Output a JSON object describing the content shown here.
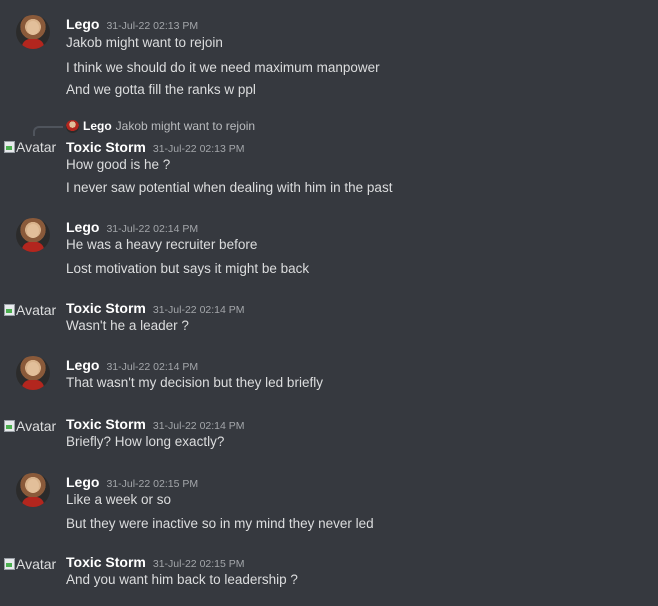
{
  "messages": [
    {
      "author": "Lego",
      "timestamp": "31-Jul-22 02:13 PM",
      "avatar": "round",
      "lines": [
        "Jakob might want to rejoin",
        "I think we should do it we need maximum manpower",
        "And we gotta fill the ranks w ppl"
      ]
    },
    {
      "author": "Toxic Storm",
      "timestamp": "31-Jul-22 02:13 PM",
      "avatar": "broken",
      "avatar_alt": "Avatar",
      "reply_to": {
        "author": "Lego",
        "text": "Jakob might want to rejoin"
      },
      "lines": [
        "How good is he ?",
        "I never saw potential when dealing with him in the past"
      ]
    },
    {
      "author": "Lego",
      "timestamp": "31-Jul-22 02:14 PM",
      "avatar": "round",
      "lines": [
        "He was a heavy recruiter before",
        "Lost motivation but says it might be back"
      ]
    },
    {
      "author": "Toxic Storm",
      "timestamp": "31-Jul-22 02:14 PM",
      "avatar": "broken",
      "avatar_alt": "Avatar",
      "lines": [
        "Wasn't he a leader ?"
      ]
    },
    {
      "author": "Lego",
      "timestamp": "31-Jul-22 02:14 PM",
      "avatar": "round",
      "lines": [
        "That wasn't my decision but they led briefly"
      ]
    },
    {
      "author": "Toxic Storm",
      "timestamp": "31-Jul-22 02:14 PM",
      "avatar": "broken",
      "avatar_alt": "Avatar",
      "lines": [
        "Briefly? How long exactly?"
      ]
    },
    {
      "author": "Lego",
      "timestamp": "31-Jul-22 02:15 PM",
      "avatar": "round",
      "lines": [
        "Like a week or so",
        "But they were inactive so in my mind they never led"
      ]
    },
    {
      "author": "Toxic Storm",
      "timestamp": "31-Jul-22 02:15 PM",
      "avatar": "broken",
      "avatar_alt": "Avatar",
      "lines": [
        "And you want him back to leadership ?"
      ]
    }
  ],
  "colors": {
    "background": "#36393f",
    "username": "#ffffff",
    "timestamp": "#a3a6aa",
    "text": "#dcddde"
  }
}
